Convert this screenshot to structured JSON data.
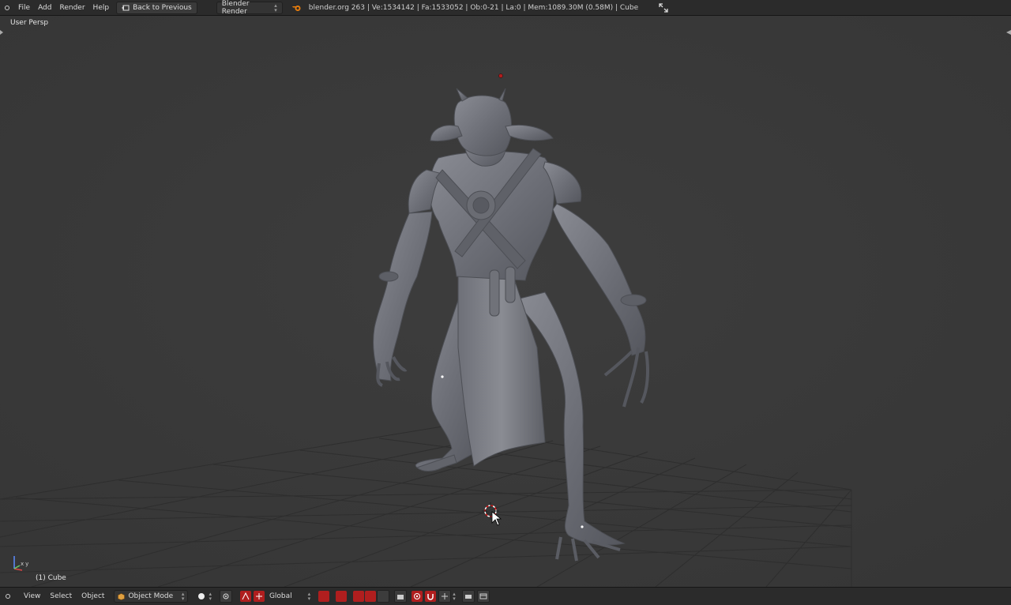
{
  "top_menu": {
    "items": [
      "File",
      "Add",
      "Render",
      "Help"
    ],
    "back_button": "Back to Previous",
    "render_engine": "Blender Render",
    "stats": "blender.org 263 | Ve:1534142 | Fa:1533052 | Ob:0-21 | La:0 | Mem:1089.30M (0.58M) | Cube"
  },
  "viewport": {
    "view_label": "User Persp",
    "object_label": "(1) Cube",
    "axis_labels": {
      "x": "x",
      "y": "y",
      "z": "z"
    }
  },
  "bottom_bar": {
    "menus": [
      "View",
      "Select",
      "Object"
    ],
    "mode": "Object Mode",
    "orientation": "Global"
  },
  "colors": {
    "viewport_bg": "#393939",
    "header_bg": "#2b2b2b",
    "accent_red": "#b01e1e",
    "model_gray": "#767880"
  }
}
